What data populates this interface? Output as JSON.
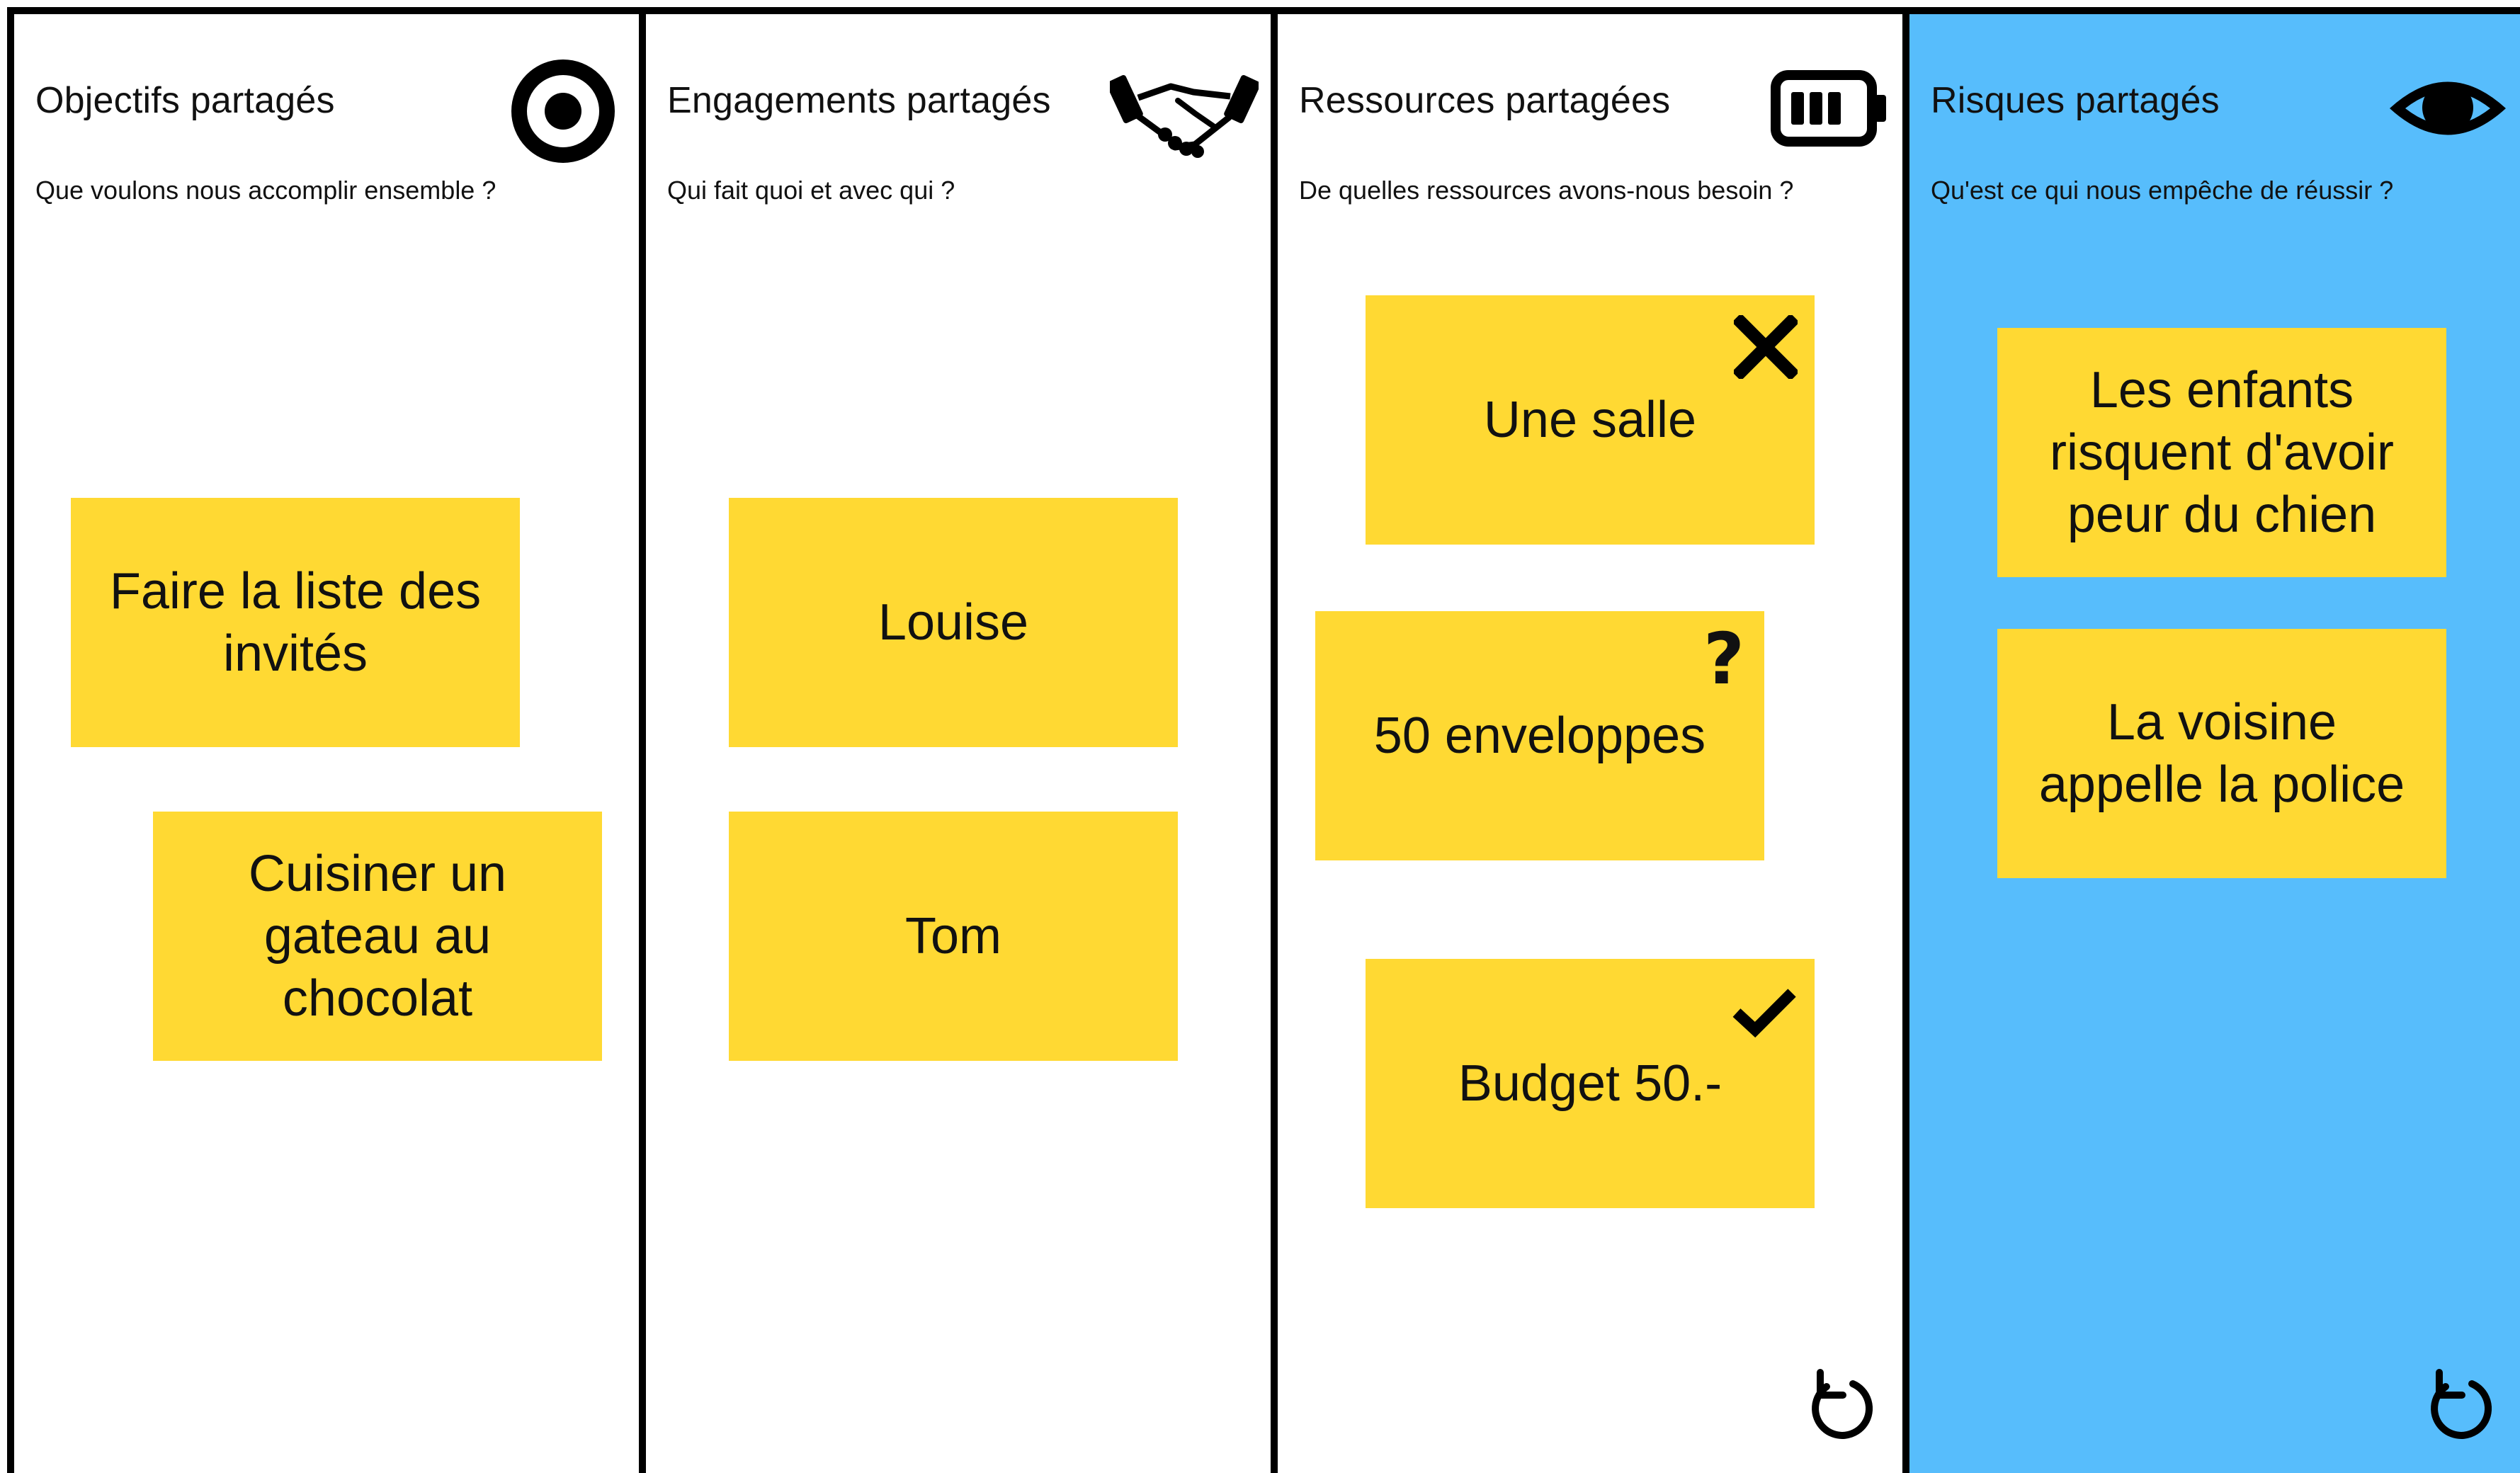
{
  "accent": {
    "note": "#ffd933",
    "highlight_column": "#57bdfc",
    "border": "#000000"
  },
  "columns": [
    {
      "title": "Objectifs partagés",
      "subtitle": "Que voulons nous accomplir ensemble ?",
      "icon": "target-icon",
      "notes": [
        "Faire la liste des invités",
        "Cuisiner un gateau au chocolat"
      ]
    },
    {
      "title": "Engagements partagés",
      "subtitle": "Qui fait quoi et avec qui ?",
      "icon": "handshake-icon",
      "notes": [
        "Louise",
        "Tom"
      ]
    },
    {
      "title": "Ressources partagées",
      "subtitle": "De quelles ressources avons-nous besoin ?",
      "icon": "battery-icon",
      "notes": [
        "Une salle",
        "50 enveloppes",
        "Budget 50.-"
      ],
      "note_marks": [
        "cross-icon",
        "question-icon",
        "check-icon"
      ],
      "question_mark": "?"
    },
    {
      "title": "Risques partagés",
      "subtitle": "Qu'est ce qui nous empêche de réussir ?",
      "icon": "eye-icon",
      "notes": [
        "Les enfants risquent d'avoir peur du chien",
        "La voisine appelle la police"
      ]
    }
  ]
}
